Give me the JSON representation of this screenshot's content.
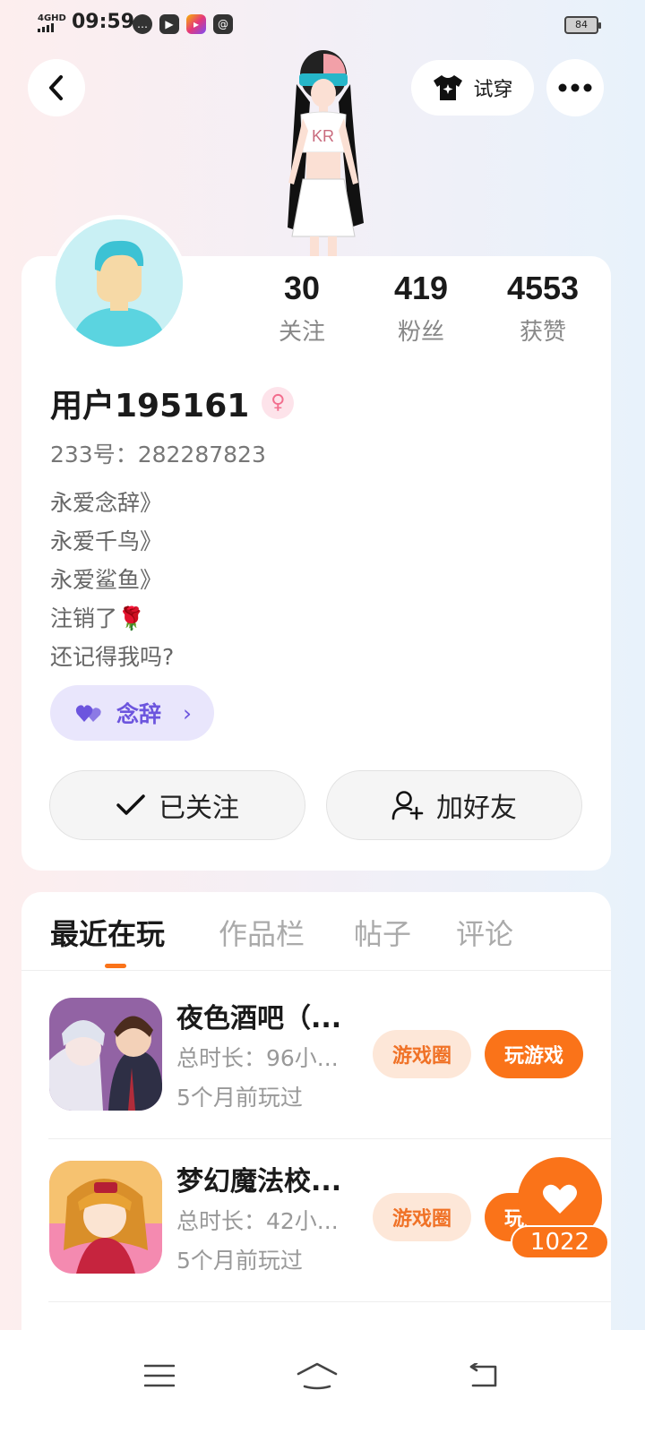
{
  "status_bar": {
    "network": "4GHD",
    "time": "09:59",
    "battery": "84"
  },
  "header": {
    "try_on_label": "试穿"
  },
  "profile": {
    "stats": [
      {
        "value": "30",
        "label": "关注"
      },
      {
        "value": "419",
        "label": "粉丝"
      },
      {
        "value": "4553",
        "label": "获赞"
      }
    ],
    "username": "用户195161",
    "gender_symbol": "♀",
    "uid_text": "233号：282287823",
    "bio_lines": [
      "永爱念辞》",
      "永爱千鸟》",
      "永爱鲨鱼》",
      "注销了🌹",
      "还记得我吗?"
    ],
    "tag_label": "念辞",
    "tag_chevron": "›",
    "follow_label": "已关注",
    "add_friend_label": "加好友"
  },
  "tabs": [
    {
      "label": "最近在玩",
      "active": true
    },
    {
      "label": "作品栏",
      "active": false
    },
    {
      "label": "帖子",
      "active": false
    },
    {
      "label": "评论",
      "active": false
    }
  ],
  "games": [
    {
      "name": "夜色酒吧（...",
      "duration": "总时长：96小...",
      "last_played": "5个月前玩过",
      "circle_label": "游戏圈",
      "play_label": "玩游戏"
    },
    {
      "name": "梦幻魔法校...",
      "duration": "总时长：42小...",
      "last_played": "5个月前玩过",
      "circle_label": "游戏圈",
      "play_label": "玩游戏"
    }
  ],
  "like": {
    "count": "1022"
  },
  "colors": {
    "accent": "#fa7319",
    "chip_bg": "#fde7d8",
    "tag_bg": "#e9e6fc",
    "tag_text": "#6c55de"
  }
}
